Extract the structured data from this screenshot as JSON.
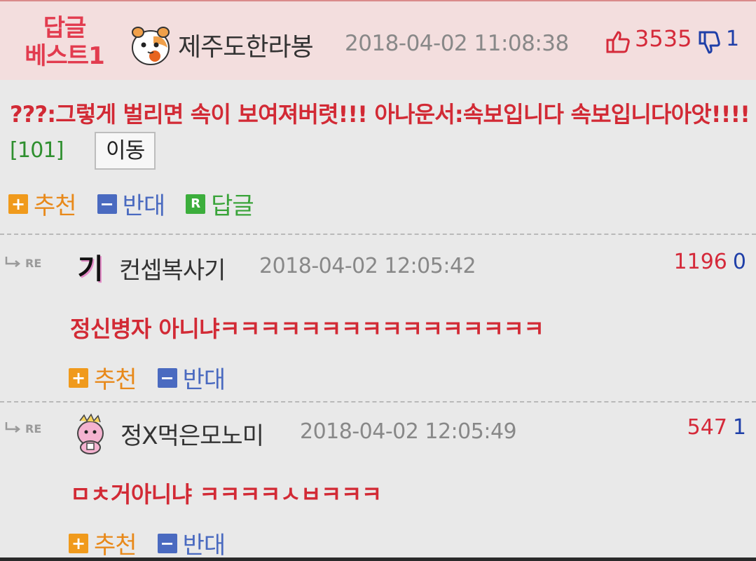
{
  "best_reply": {
    "badge_line1": "답글",
    "badge_line2": "베스트1",
    "author": "제주도한라봉",
    "date": "2018-04-02 11:08:38",
    "upvotes": "3535",
    "downvotes": "1",
    "text": "???:그렇게 벌리면 속이 보여져버렷!!! 아나운서:속보입니다 속보입니다아앗!!!!",
    "reply_count": "[101]",
    "move_label": "이동",
    "actions": {
      "recommend": "추천",
      "oppose": "반대",
      "reply": "답글"
    }
  },
  "sub_replies": [
    {
      "re_label": "RE",
      "author": "컨셉복사기",
      "avatar_text": "기",
      "date": "2018-04-02 12:05:42",
      "upvotes": "1196",
      "downvotes": "0",
      "text": "정신병자 아니냐ㅋㅋㅋㅋㅋㅋㅋㅋㅋㅋㅋㅋㅋㅋㅋㅋ",
      "actions": {
        "recommend": "추천",
        "oppose": "반대"
      }
    },
    {
      "re_label": "RE",
      "author": "정X먹은모노미",
      "date": "2018-04-02 12:05:49",
      "upvotes": "547",
      "downvotes": "1",
      "text": "ㅁㅊ거아니냐 ㅋㅋㅋㅋㅅㅂㅋㅋㅋ",
      "actions": {
        "recommend": "추천",
        "oppose": "반대"
      }
    }
  ],
  "icons": {
    "thumbs_up": "thumbs-up-icon",
    "thumbs_down": "thumbs-down-icon",
    "plus": "plus-icon",
    "minus": "minus-icon",
    "reply": "reply-icon",
    "re_arrow": "reply-arrow-icon"
  },
  "colors": {
    "best_header_bg": "#f3dede",
    "badge_red": "#e23c4f",
    "text_red": "#d22a35",
    "down_blue": "#1f3fa8",
    "recommend_orange": "#f09a1c",
    "oppose_blue": "#4a6ac0",
    "reply_green": "#3cae3c"
  }
}
